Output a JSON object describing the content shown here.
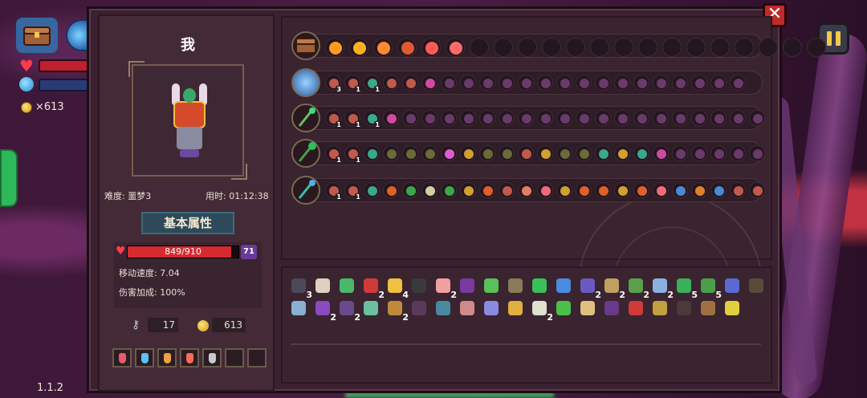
{
  "hud": {
    "coins": "×613",
    "version": "1.1.2"
  },
  "header": {
    "close_label": "✕"
  },
  "player": {
    "name": "我",
    "difficulty": "难度: 噩梦3",
    "time": "用时: 01:12:38",
    "attributes_title": "基本属性",
    "hp_text": "849/910",
    "hp_fraction": 0.933,
    "shield": "71",
    "move_speed": "移动速度: 7.04",
    "damage_bonus": "伤害加成: 100%",
    "keys": "17",
    "coins": "613"
  },
  "colors": {
    "accent_gold": "#f2c84a",
    "hp_red": "#d42a30",
    "close_red": "#c02a2a"
  },
  "potions": [
    {
      "icon": "red-potion-icon",
      "color": "#e85a6a"
    },
    {
      "icon": "blue-potion-icon",
      "color": "#5ac0ff"
    },
    {
      "icon": "orange-potion-icon",
      "color": "#f0a040"
    },
    {
      "icon": "red-potion-icon",
      "color": "#ff6a5a"
    },
    {
      "icon": "gray-potion-icon",
      "color": "#c8c8d0"
    },
    {
      "icon": "empty-slot",
      "color": ""
    },
    {
      "icon": "empty-slot",
      "color": ""
    }
  ],
  "buff_row": {
    "icon": "chest-icon",
    "filled": [
      {
        "icon": "sun-icon",
        "color": "#ff9a20"
      },
      {
        "icon": "sun-icon",
        "color": "#ffb020"
      },
      {
        "icon": "crossed-swords-icon",
        "color": "#ff8a30"
      },
      {
        "icon": "hourglass-icon",
        "color": "#e05a30"
      },
      {
        "icon": "runner-icon",
        "color": "#ff5a5a"
      },
      {
        "icon": "runner-icon",
        "color": "#ff6a6a"
      }
    ],
    "empty": 15
  },
  "weapon_rows": [
    {
      "icon": "crystal-orb-icon",
      "slots": [
        {
          "c": "#c05a4a",
          "n": "3"
        },
        {
          "c": "#c05a4a",
          "n": "1"
        },
        {
          "c": "#3aa88a",
          "n": "1"
        },
        {
          "c": "#c05a4a",
          "n": ""
        },
        {
          "c": "#c05a4a",
          "n": ""
        },
        {
          "c": "#d04aa0",
          "n": ""
        },
        {
          "c": "#6a3a6a",
          "n": ""
        },
        {
          "c": "#6a3a6a",
          "n": ""
        },
        {
          "c": "#6a3a6a",
          "n": ""
        },
        {
          "c": "#6a3a6a",
          "n": ""
        },
        {
          "c": "#6a3a6a",
          "n": ""
        },
        {
          "c": "#6a3a6a",
          "n": ""
        },
        {
          "c": "#6a3a6a",
          "n": ""
        },
        {
          "c": "#6a3a6a",
          "n": ""
        },
        {
          "c": "#6a3a6a",
          "n": ""
        },
        {
          "c": "#6a3a6a",
          "n": ""
        },
        {
          "c": "#6a3a6a",
          "n": ""
        },
        {
          "c": "#6a3a6a",
          "n": ""
        },
        {
          "c": "#6a3a6a",
          "n": ""
        },
        {
          "c": "#6a3a6a",
          "n": ""
        },
        {
          "c": "#6a3a6a",
          "n": ""
        },
        {
          "c": "#6a3a6a",
          "n": ""
        }
      ]
    },
    {
      "icon": "green-staff-icon",
      "slots": [
        {
          "c": "#c05a4a",
          "n": "1"
        },
        {
          "c": "#c05a4a",
          "n": "1"
        },
        {
          "c": "#3aa88a",
          "n": "1"
        },
        {
          "c": "#d04aa0",
          "n": ""
        },
        {
          "c": "#6a3a6a",
          "n": ""
        },
        {
          "c": "#6a3a6a",
          "n": ""
        },
        {
          "c": "#6a3a6a",
          "n": ""
        },
        {
          "c": "#6a3a6a",
          "n": ""
        },
        {
          "c": "#6a3a6a",
          "n": ""
        },
        {
          "c": "#6a3a6a",
          "n": ""
        },
        {
          "c": "#6a3a6a",
          "n": ""
        },
        {
          "c": "#6a3a6a",
          "n": ""
        },
        {
          "c": "#6a3a6a",
          "n": ""
        },
        {
          "c": "#6a3a6a",
          "n": ""
        },
        {
          "c": "#6a3a6a",
          "n": ""
        },
        {
          "c": "#6a3a6a",
          "n": ""
        },
        {
          "c": "#6a3a6a",
          "n": ""
        },
        {
          "c": "#6a3a6a",
          "n": ""
        },
        {
          "c": "#6a3a6a",
          "n": ""
        },
        {
          "c": "#6a3a6a",
          "n": ""
        },
        {
          "c": "#6a3a6a",
          "n": ""
        },
        {
          "c": "#6a3a6a",
          "n": ""
        },
        {
          "c": "#6a3a6a",
          "n": ""
        }
      ]
    },
    {
      "icon": "emerald-staff-icon",
      "slots": [
        {
          "c": "#c05a4a",
          "n": "1"
        },
        {
          "c": "#c05a4a",
          "n": "1"
        },
        {
          "c": "#3aa88a",
          "n": ""
        },
        {
          "c": "#6a6a3a",
          "n": ""
        },
        {
          "c": "#6a6a3a",
          "n": ""
        },
        {
          "c": "#6a6a3a",
          "n": ""
        },
        {
          "c": "#e05ad0",
          "n": ""
        },
        {
          "c": "#d0a030",
          "n": ""
        },
        {
          "c": "#6a6a3a",
          "n": ""
        },
        {
          "c": "#6a6a3a",
          "n": ""
        },
        {
          "c": "#c05a4a",
          "n": ""
        },
        {
          "c": "#d0a030",
          "n": ""
        },
        {
          "c": "#6a6a3a",
          "n": ""
        },
        {
          "c": "#6a6a3a",
          "n": ""
        },
        {
          "c": "#3aa88a",
          "n": ""
        },
        {
          "c": "#d0a030",
          "n": ""
        },
        {
          "c": "#3aa88a",
          "n": ""
        },
        {
          "c": "#d04aa0",
          "n": ""
        },
        {
          "c": "#6a3a6a",
          "n": ""
        },
        {
          "c": "#6a3a6a",
          "n": ""
        },
        {
          "c": "#6a3a6a",
          "n": ""
        },
        {
          "c": "#6a3a6a",
          "n": ""
        },
        {
          "c": "#6a3a6a",
          "n": ""
        }
      ]
    },
    {
      "icon": "blue-staff-icon",
      "slots": [
        {
          "c": "#c05a4a",
          "n": "1"
        },
        {
          "c": "#c05a4a",
          "n": "1"
        },
        {
          "c": "#3aa88a",
          "n": ""
        },
        {
          "c": "#e0602a",
          "n": ""
        },
        {
          "c": "#3aa84a",
          "n": ""
        },
        {
          "c": "#d0d0a0",
          "n": ""
        },
        {
          "c": "#3aa84a",
          "n": ""
        },
        {
          "c": "#d0a030",
          "n": ""
        },
        {
          "c": "#e0602a",
          "n": ""
        },
        {
          "c": "#c05a4a",
          "n": ""
        },
        {
          "c": "#e08060",
          "n": ""
        },
        {
          "c": "#f06a7a",
          "n": ""
        },
        {
          "c": "#d0a030",
          "n": ""
        },
        {
          "c": "#e0602a",
          "n": ""
        },
        {
          "c": "#e0602a",
          "n": ""
        },
        {
          "c": "#d0a030",
          "n": ""
        },
        {
          "c": "#e0602a",
          "n": ""
        },
        {
          "c": "#f06a7a",
          "n": ""
        },
        {
          "c": "#4a8ad0",
          "n": ""
        },
        {
          "c": "#e0802a",
          "n": ""
        },
        {
          "c": "#4a8ad0",
          "n": ""
        },
        {
          "c": "#c05a4a",
          "n": ""
        },
        {
          "c": "#c05a4a",
          "n": ""
        }
      ]
    }
  ],
  "items_row1": [
    {
      "icon": "skull-icon",
      "c": "#4a4a5a",
      "n": "3"
    },
    {
      "icon": "feather-icon",
      "c": "#e0d0c0",
      "n": ""
    },
    {
      "icon": "green-crystal-icon",
      "c": "#4ab86a",
      "n": ""
    },
    {
      "icon": "red-clock-icon",
      "c": "#d03a3a",
      "n": "2"
    },
    {
      "icon": "yellow-flag-icon",
      "c": "#f0c040",
      "n": "4"
    },
    {
      "icon": "dark-gear-icon",
      "c": "#3a3a3a",
      "n": ""
    },
    {
      "icon": "pink-pig-icon",
      "c": "#f0a0a0",
      "n": "2"
    },
    {
      "icon": "witch-hat-icon",
      "c": "#7a3aa0",
      "n": ""
    },
    {
      "icon": "sprout-icon",
      "c": "#5ac05a",
      "n": ""
    },
    {
      "icon": "bottle-icon",
      "c": "#8a7a5a",
      "n": ""
    },
    {
      "icon": "green-claw-icon",
      "c": "#3ac05a",
      "n": ""
    },
    {
      "icon": "blue-gem-icon",
      "c": "#4a8ae0",
      "n": ""
    },
    {
      "icon": "potion-icon",
      "c": "#6a5ac0",
      "n": "2"
    },
    {
      "icon": "scroll-icon",
      "c": "#c0a060",
      "n": "2"
    },
    {
      "icon": "green-helmet-icon",
      "c": "#5aa04a",
      "n": "2"
    },
    {
      "icon": "egg-icon",
      "c": "#8ab0e0",
      "n": "2"
    },
    {
      "icon": "clover-icon",
      "c": "#3ab05a",
      "n": "5"
    },
    {
      "icon": "slug-icon",
      "c": "#4aa04a",
      "n": "5"
    },
    {
      "icon": "blue-vial-icon",
      "c": "#5a6ad0",
      "n": ""
    },
    {
      "icon": "dark-cloak-icon",
      "c": "#5a4a3a",
      "n": ""
    }
  ],
  "items_row2": [
    {
      "icon": "key-icon",
      "c": "#8ab0d0",
      "n": ""
    },
    {
      "icon": "purple-boot-icon",
      "c": "#8a4ac0",
      "n": "2"
    },
    {
      "icon": "spellbook-icon",
      "c": "#6a4a8a",
      "n": "2"
    },
    {
      "icon": "dagger-icon",
      "c": "#6ac0a0",
      "n": ""
    },
    {
      "icon": "barrel-icon",
      "c": "#c08a3a",
      "n": "2"
    },
    {
      "icon": "dark-robe-icon",
      "c": "#5a3a5a",
      "n": ""
    },
    {
      "icon": "crystal-ball-icon",
      "c": "#4a8aa0",
      "n": ""
    },
    {
      "icon": "pink-shield-icon",
      "c": "#d08a8a",
      "n": ""
    },
    {
      "icon": "vial-icon",
      "c": "#8a8ae0",
      "n": ""
    },
    {
      "icon": "yellow-map-icon",
      "c": "#e0b040",
      "n": ""
    },
    {
      "icon": "fang-icon",
      "c": "#e0e0d0",
      "n": "2"
    },
    {
      "icon": "green-amulet-icon",
      "c": "#4ac04a",
      "n": ""
    },
    {
      "icon": "feather-quill-icon",
      "c": "#e0c080",
      "n": ""
    },
    {
      "icon": "purple-hat-icon",
      "c": "#6a3a8a",
      "n": ""
    },
    {
      "icon": "red-mask-icon",
      "c": "#d03a3a",
      "n": ""
    },
    {
      "icon": "antler-icon",
      "c": "#c0a040",
      "n": ""
    },
    {
      "icon": "dark-cape-icon",
      "c": "#4a3a3a",
      "n": ""
    },
    {
      "icon": "brown-chest-icon",
      "c": "#a07040",
      "n": ""
    },
    {
      "icon": "yellow-feather-icon",
      "c": "#e0d040",
      "n": ""
    }
  ]
}
